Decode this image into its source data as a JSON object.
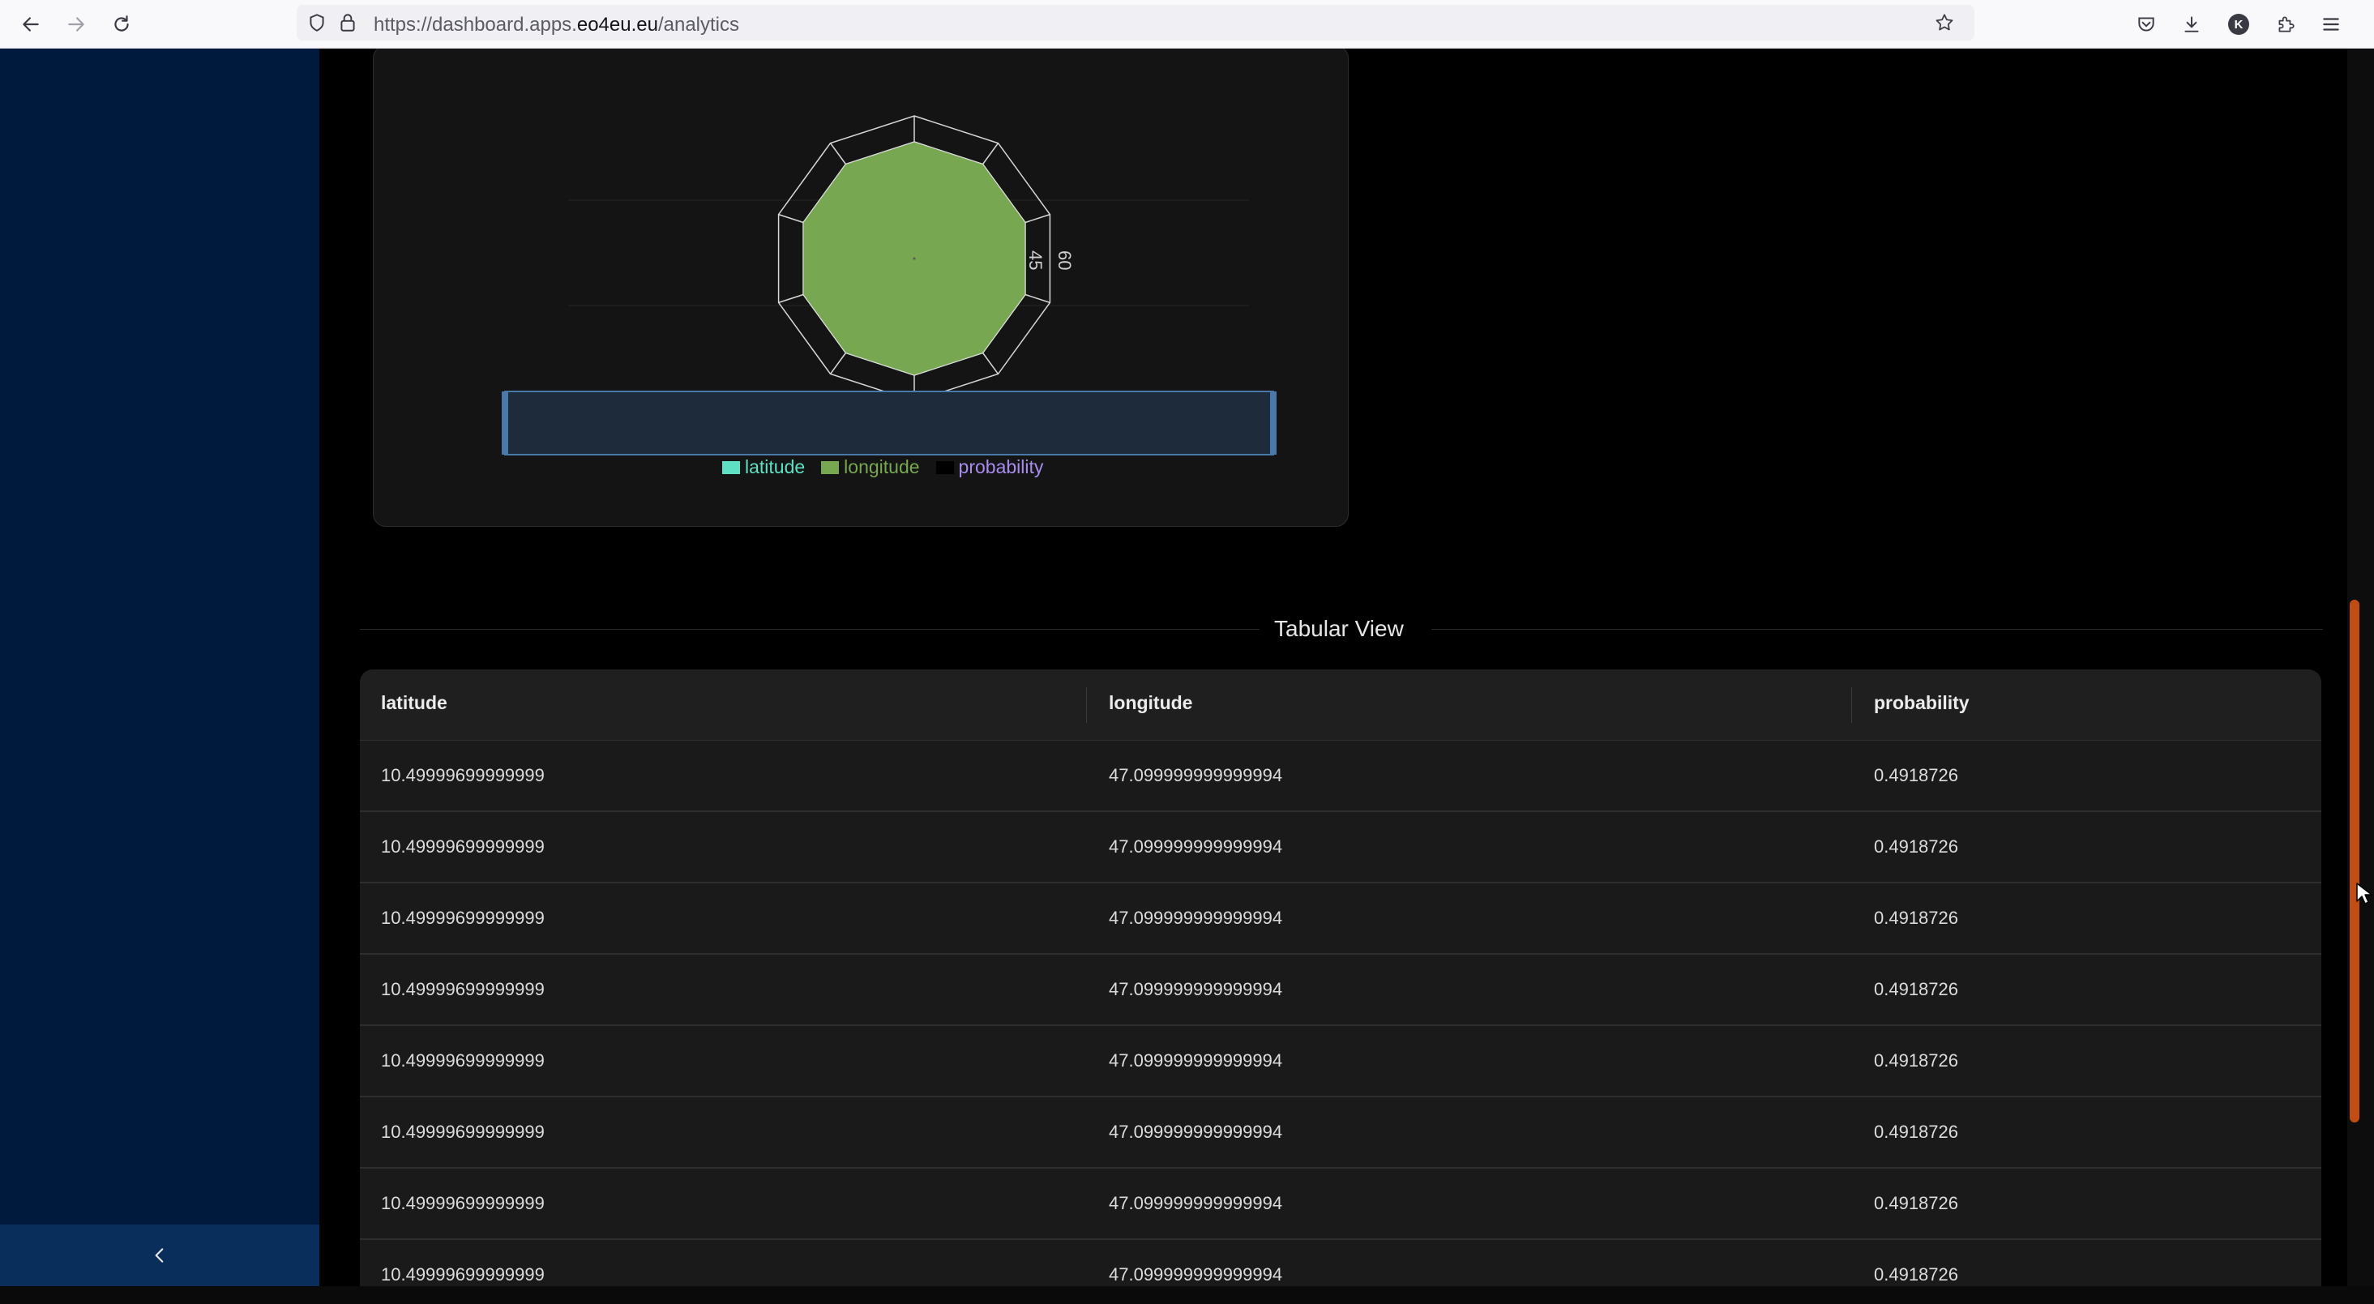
{
  "browser": {
    "url_prefix": "https://dashboard.apps.",
    "url_host": "eo4eu.eu",
    "url_path": "/analytics",
    "account_initial": "K"
  },
  "chart": {
    "radial_ticks": [
      "45",
      "60"
    ],
    "legend": [
      {
        "label": "latitude",
        "color": "#5ee0c4",
        "text_color": "#5ee0c4"
      },
      {
        "label": "longitude",
        "color": "#77a851",
        "text_color": "#77a851"
      },
      {
        "label": "probability",
        "color": "#000000",
        "text_color": "#a98bf0"
      }
    ],
    "fill_color": "#77a851"
  },
  "chart_data": {
    "type": "radar",
    "series": [
      {
        "name": "latitude",
        "values": [
          10.49999699999999
        ]
      },
      {
        "name": "longitude",
        "values": [
          47.099999999999994
        ]
      },
      {
        "name": "probability",
        "values": [
          0.4918726
        ]
      }
    ],
    "radial_ticks": [
      45,
      60
    ]
  },
  "section": {
    "title": "Tabular View"
  },
  "table": {
    "columns": [
      "latitude",
      "longitude",
      "probability"
    ],
    "rows": [
      [
        "10.49999699999999",
        "47.099999999999994",
        "0.4918726"
      ],
      [
        "10.49999699999999",
        "47.099999999999994",
        "0.4918726"
      ],
      [
        "10.49999699999999",
        "47.099999999999994",
        "0.4918726"
      ],
      [
        "10.49999699999999",
        "47.099999999999994",
        "0.4918726"
      ],
      [
        "10.49999699999999",
        "47.099999999999994",
        "0.4918726"
      ],
      [
        "10.49999699999999",
        "47.099999999999994",
        "0.4918726"
      ],
      [
        "10.49999699999999",
        "47.099999999999994",
        "0.4918726"
      ],
      [
        "10.49999699999999",
        "47.099999999999994",
        "0.4918726"
      ]
    ]
  },
  "colors": {
    "sidebar": "#001a3d",
    "scrollbar_thumb": "#c24d14"
  },
  "icons": {
    "back": "arrow-left-icon",
    "forward": "arrow-right-icon",
    "reload": "reload-icon",
    "shield": "shield-icon",
    "lock": "lock-icon",
    "star": "star-icon",
    "pocket": "pocket-icon",
    "download": "download-icon",
    "extensions": "puzzle-icon",
    "menu": "hamburger-icon",
    "collapse": "chevron-left-icon"
  }
}
